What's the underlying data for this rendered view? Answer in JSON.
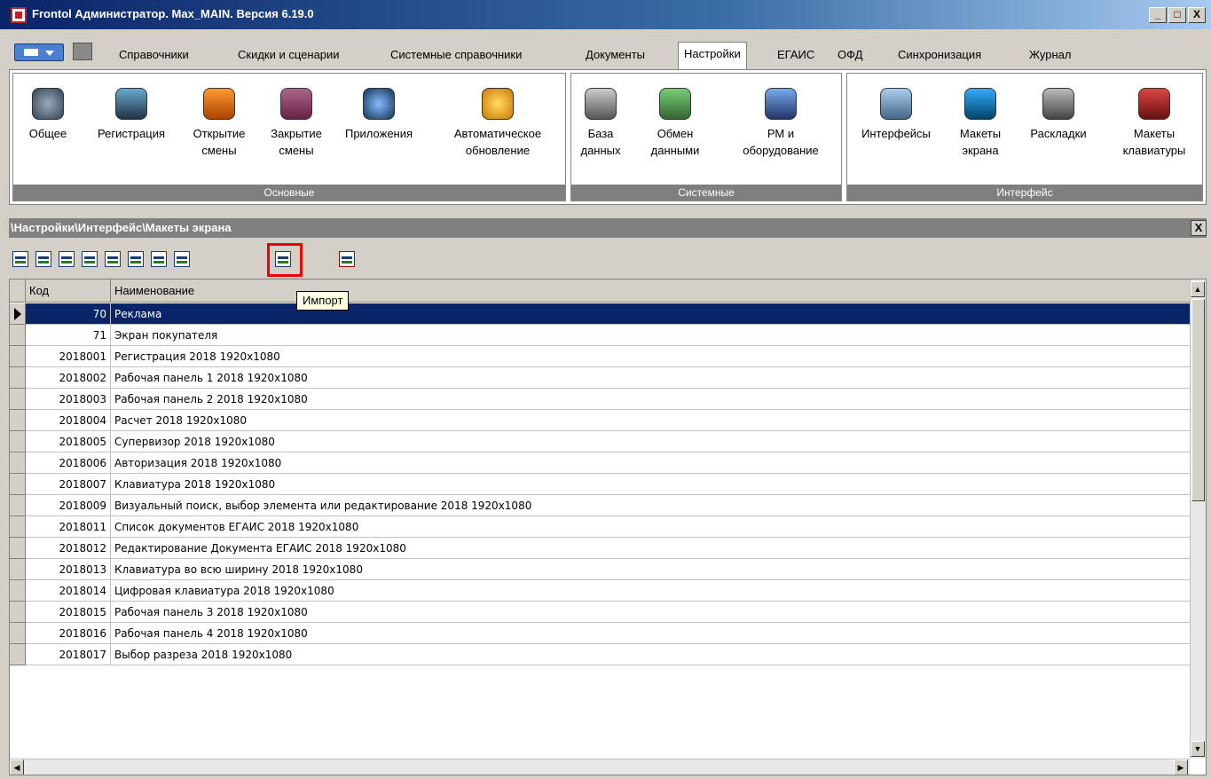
{
  "window": {
    "title": "Frontol Администратор. Max_MAIN. Версия 6.19.0",
    "controls": [
      "_",
      "□",
      "X"
    ]
  },
  "menu": {
    "tabs": [
      {
        "label": "Справочники"
      },
      {
        "label": "Скидки и сценарии"
      },
      {
        "label": "Системные справочники"
      },
      {
        "label": "Документы"
      },
      {
        "label": "Настройки",
        "active": true
      },
      {
        "label": "ЕГАИС"
      },
      {
        "label": "ОФД"
      },
      {
        "label": "Синхронизация"
      },
      {
        "label": "Журнал"
      }
    ]
  },
  "ribbon": {
    "groups": [
      {
        "label": "Основные",
        "buttons": [
          {
            "label": "Общее",
            "icon": "gear-icon"
          },
          {
            "label": "Регистрация",
            "icon": "box-icon"
          },
          {
            "label": "Открытие\nсмены",
            "icon": "shop-open-icon"
          },
          {
            "label": "Закрытие\nсмены",
            "icon": "shop-close-icon"
          },
          {
            "label": "Приложения",
            "icon": "star-icon"
          },
          {
            "label": "Автоматическое\nобновление",
            "icon": "update-icon"
          }
        ]
      },
      {
        "label": "Системные",
        "buttons": [
          {
            "label": "База\nданных",
            "icon": "database-icon"
          },
          {
            "label": "Обмен\nданными",
            "icon": "exchange-icon"
          },
          {
            "label": "РМ и\nоборудование",
            "icon": "workstation-icon"
          }
        ]
      },
      {
        "label": "Интерфейс",
        "buttons": [
          {
            "label": "Интерфейсы",
            "icon": "dialog-icon"
          },
          {
            "label": "Макеты\nэкрана",
            "icon": "monitor-icon"
          },
          {
            "label": "Раскладки",
            "icon": "keyboard-icon"
          },
          {
            "label": "Макеты\nклавиатуры",
            "icon": "keypad-icon"
          }
        ]
      }
    ]
  },
  "panel": {
    "breadcrumb": "\\Настройки\\Интерфейс\\Макеты экрана",
    "close": "X",
    "tooltip": "Импорт"
  },
  "grid": {
    "columns": [
      "Код",
      "Наименование"
    ],
    "rows": [
      {
        "code": "70",
        "name": "Реклама",
        "selected": true
      },
      {
        "code": "71",
        "name": "Экран покупателя"
      },
      {
        "code": "2018001",
        "name": "Регистрация 2018 1920x1080"
      },
      {
        "code": "2018002",
        "name": "Рабочая панель 1 2018 1920x1080"
      },
      {
        "code": "2018003",
        "name": "Рабочая панель 2 2018 1920x1080"
      },
      {
        "code": "2018004",
        "name": "Расчет 2018 1920x1080"
      },
      {
        "code": "2018005",
        "name": "Супервизор 2018 1920x1080"
      },
      {
        "code": "2018006",
        "name": "Авторизация 2018 1920x1080"
      },
      {
        "code": "2018007",
        "name": "Клавиатура 2018 1920x1080"
      },
      {
        "code": "2018009",
        "name": "Визуальный поиск, выбор элемента или редактирование 2018 1920x1080"
      },
      {
        "code": "2018011",
        "name": "Список документов ЕГАИС 2018 1920x1080"
      },
      {
        "code": "2018012",
        "name": "Редактирование Документа ЕГАИС 2018 1920x1080"
      },
      {
        "code": "2018013",
        "name": "Клавиатура во всю ширину 2018 1920x1080"
      },
      {
        "code": "2018014",
        "name": "Цифровая клавиатура 2018 1920x1080"
      },
      {
        "code": "2018015",
        "name": "Рабочая панель 3 2018 1920x1080"
      },
      {
        "code": "2018016",
        "name": "Рабочая панель 4 2018 1920x1080"
      },
      {
        "code": "2018017",
        "name": "Выбор разреза 2018 1920x1080"
      }
    ]
  }
}
